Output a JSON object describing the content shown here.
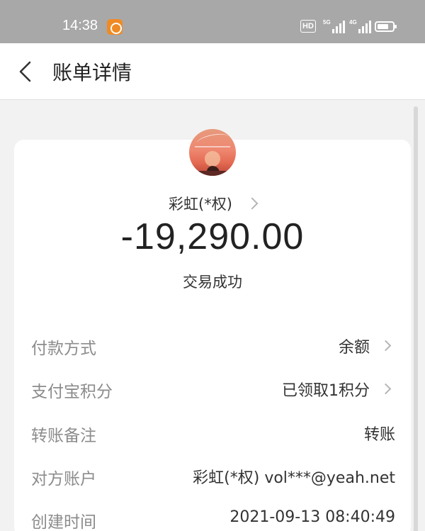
{
  "status_bar": {
    "time": "14:38",
    "hd_label": "HD",
    "signal_1_label": "5G",
    "signal_2_label": "4G",
    "icons": [
      "app-notification-icon",
      "hd-icon",
      "signal-5g-icon",
      "signal-4g-icon",
      "battery-icon"
    ]
  },
  "nav": {
    "back_icon": "chevron-left-icon",
    "title": "账单详情"
  },
  "transaction": {
    "payee": "彩虹(*权)",
    "amount": "-19,290.00",
    "status": "交易成功"
  },
  "details": [
    {
      "label": "付款方式",
      "value": "余额"
    },
    {
      "label": "支付宝积分",
      "value": "已领取1积分"
    },
    {
      "label": "转账备注",
      "value": "转账"
    },
    {
      "label": "对方账户",
      "value": "彩虹(*权) vol***@yeah.net"
    },
    {
      "label": "创建时间",
      "value": "2021-09-13 08:40:49"
    }
  ],
  "colors": {
    "status_bar": "#a8a8a8",
    "page_bg": "#f2f2f2",
    "card_bg": "#ffffff",
    "label_text": "#8c8c8c",
    "value_text": "#333333"
  }
}
